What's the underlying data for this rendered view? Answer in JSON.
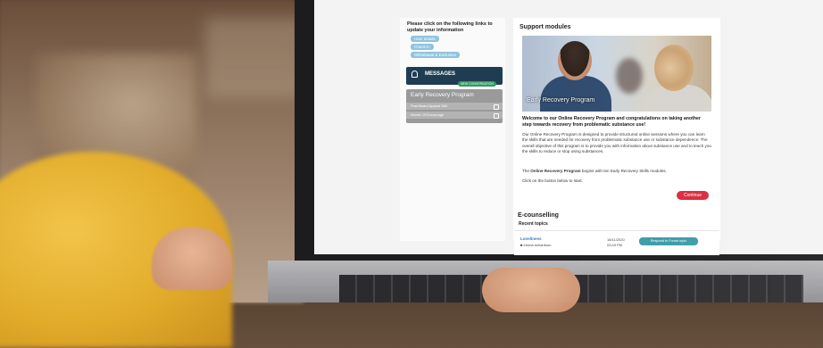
{
  "sidebar": {
    "links_title": "Please click on the following links to update your information",
    "links": [
      "User details",
      "Check-in",
      "Withdrawal & Exclusion"
    ],
    "messages_label": "MESSAGES",
    "new_conversation": "NEW CONVERSATION",
    "program_title": "Early Recovery Program",
    "program_rows": [
      "Post Board Appeal 360",
      "Words Of Encourage"
    ]
  },
  "main": {
    "support_heading": "Support modules",
    "hero_caption": "Early Recovery Program",
    "welcome": "Welcome to our Online Recovery Program and congratulations on taking another step towards recovery from problematic substance use!",
    "paragraph1": "Our Online Recovery Program is designed to provide structured online sessions where you can learn the skills that are needed for recovery from problematic substance use or substance dependence. The overall objective of this program is to provide you with information about substance use and to teach you the skills to reduce or stop using substances.",
    "paragraph2_prefix": "The",
    "paragraph2_bold": "Online Recovery Program",
    "paragraph2_suffix": "begins with ten Early Recovery Skills modules.",
    "paragraph3": "Click on the button below to start.",
    "continue_label": "Continue",
    "ecounselling_heading": "E-counselling",
    "recent_topics": "Recent topics",
    "topic": {
      "title": "Loneliness",
      "user": "emma.richardson",
      "date": "18/11/2020",
      "time": "03:43 PM",
      "button": "Respond to Forum topic"
    }
  }
}
